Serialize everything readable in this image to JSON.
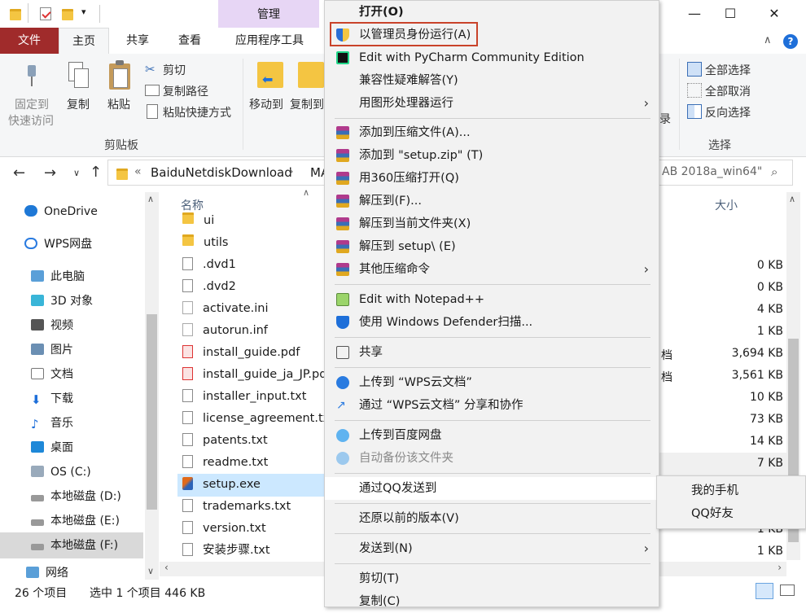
{
  "window": {
    "manage_tab": "管理",
    "minimize_glyph": "—",
    "maximize_glyph": "☐",
    "close_glyph": "✕"
  },
  "ribbon_tabs": [
    "文件",
    "主页",
    "共享",
    "查看",
    "应用程序工具"
  ],
  "ribbon": {
    "pin_label_1": "固定到",
    "pin_label_2": "快速访问",
    "copy": "复制",
    "paste": "粘贴",
    "cut": "剪切",
    "copy_path": "复制路径",
    "paste_shortcut": "粘贴快捷方式",
    "clipboard_group": "剪贴板",
    "move_to": "移动到",
    "copy_to": "复制到",
    "select_all": "全部选择",
    "select_none": "全部取消",
    "invert_select": "反向选择",
    "select_group": "选择",
    "history_partial": "录"
  },
  "address": {
    "crumb_sep": "«",
    "crumb_1": "BaiduNetdiskDownload",
    "crumb_2": "MA",
    "search_placeholder": "AB 2018a_win64\""
  },
  "nav": {
    "items": [
      "OneDrive",
      "WPS网盘",
      "此电脑",
      "3D 对象",
      "视频",
      "图片",
      "文档",
      "下载",
      "音乐",
      "桌面",
      "OS (C:)",
      "本地磁盘 (D:)",
      "本地磁盘 (E:)",
      "本地磁盘 (F:)",
      "网络"
    ]
  },
  "columns": {
    "name": "名称",
    "size": "大小"
  },
  "files": [
    {
      "name": "ui",
      "size": ""
    },
    {
      "name": "utils",
      "size": ""
    },
    {
      "name": ".dvd1",
      "size": "0 KB"
    },
    {
      "name": ".dvd2",
      "size": "0 KB"
    },
    {
      "name": "activate.ini",
      "size": "4 KB"
    },
    {
      "name": "autorun.inf",
      "size": "1 KB"
    },
    {
      "name": "install_guide.pdf",
      "size": "3,694 KB"
    },
    {
      "name": "install_guide_ja_JP.pd",
      "size": "3,561 KB"
    },
    {
      "name": "installer_input.txt",
      "size": "10 KB"
    },
    {
      "name": "license_agreement.tx",
      "size": "73 KB"
    },
    {
      "name": "patents.txt",
      "size": "14 KB"
    },
    {
      "name": "readme.txt",
      "size": "7 KB"
    },
    {
      "name": "setup.exe",
      "size": ""
    },
    {
      "name": "trademarks.txt",
      "size": ""
    },
    {
      "name": "version.txt",
      "size": "1 KB"
    },
    {
      "name": "安装步骤.txt",
      "size": "1 KB"
    }
  ],
  "type_partial": [
    "档",
    "档"
  ],
  "context_menu": {
    "open": "打开(O)",
    "run_as_admin": "以管理员身份运行(A)",
    "pycharm": "Edit with PyCharm Community Edition",
    "compat": "兼容性疑难解答(Y)",
    "gpu": "用图形处理器运行",
    "add_archive": "添加到压缩文件(A)...",
    "add_zip": "添加到 \"setup.zip\" (T)",
    "open_360": "用360压缩打开(Q)",
    "extract_to": "解压到(F)...",
    "extract_here": "解压到当前文件夹(X)",
    "extract_setup": "解压到 setup\\ (E)",
    "other_cmds": "其他压缩命令",
    "notepad": "Edit with Notepad++",
    "defender": "使用 Windows Defender扫描...",
    "share": "共享",
    "upload_wps": "上传到 “WPS云文档”",
    "share_wps": "通过 “WPS云文档” 分享和协作",
    "upload_baidu": "上传到百度网盘",
    "backup_baidu": "自动备份该文件夹",
    "send_qq": "通过QQ发送到",
    "restore": "还原以前的版本(V)",
    "send_to": "发送到(N)",
    "cut": "剪切(T)",
    "copy": "复制(C)"
  },
  "submenu": {
    "my_phone": "我的手机",
    "qq_friend": "QQ好友"
  },
  "status": {
    "count": "26 个项目",
    "selected": "选中 1 个项目  446 KB"
  },
  "colors": {
    "file_tab": "#a02b2b",
    "manage_tab": "#e7d6f5",
    "highlight_border": "#c9432a",
    "selected_row": "#cce8ff"
  }
}
